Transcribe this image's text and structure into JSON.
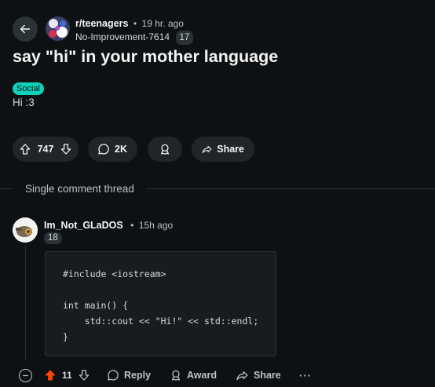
{
  "post": {
    "subreddit": "r/teenagers",
    "dot": "•",
    "time": "19 hr. ago",
    "author": "No-Improvement-7614",
    "author_badge": "17",
    "title": "say \"hi\" in your mother language",
    "flair": "Social",
    "flair_color": "#0dd3bb",
    "body": "Hi :3"
  },
  "post_actions": {
    "upvotes": "747",
    "comments": "2K",
    "share": "Share"
  },
  "thread_label": "Single comment thread",
  "comment": {
    "author": "Im_Not_GLaDOS",
    "dot": "•",
    "time": "15h ago",
    "badge": "18",
    "code_lines": [
      "#include <iostream>",
      "",
      "int main() {",
      "    std::cout << \"Hi!\" << std::endl;",
      "}"
    ],
    "votes": "11",
    "upvote_color": "#ff4500",
    "reply": "Reply",
    "award": "Award",
    "share": "Share",
    "more": "···"
  }
}
